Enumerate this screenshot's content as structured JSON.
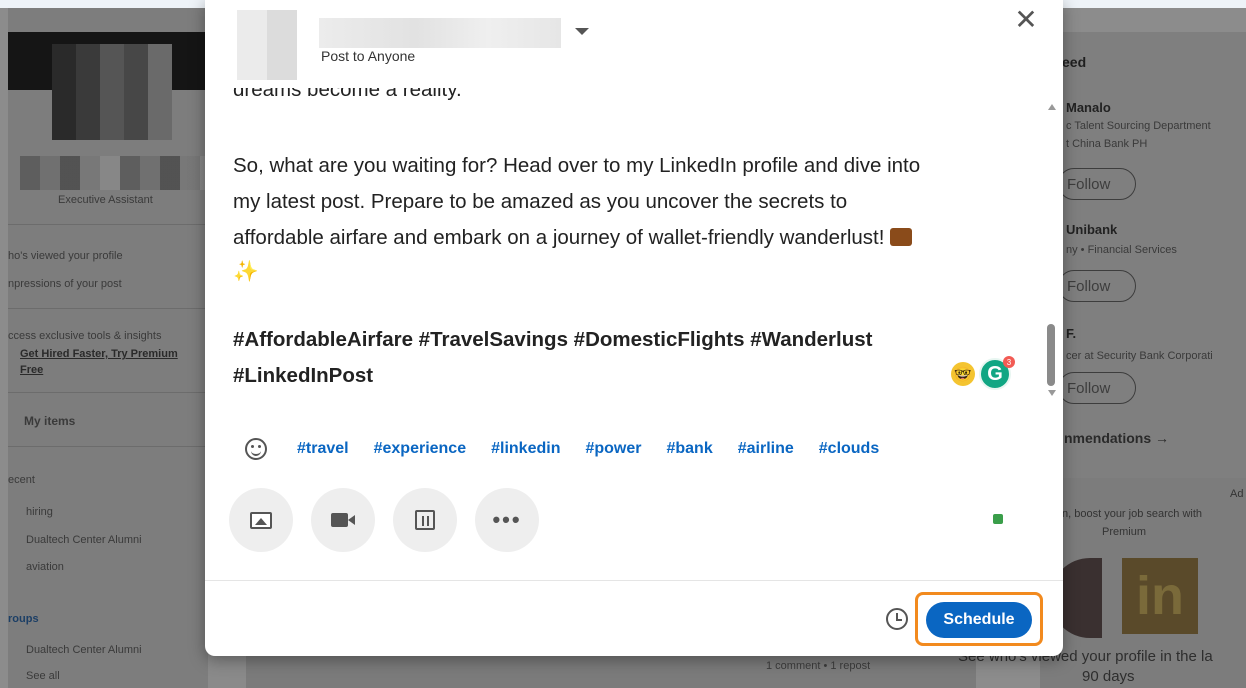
{
  "modal": {
    "visibility_label": "Post to Anyone",
    "close_glyph": "✕",
    "editor": {
      "cut_line": "dreams become a reality.",
      "paragraph_lines": [
        "So, what are you waiting for? Head over to my LinkedIn profile and dive into",
        "my latest post. Prepare to be amazed as you uncover the secrets to",
        "affordable airfare and embark on a journey of wallet-friendly wanderlust!",
        "✨"
      ],
      "hashtag_lines": [
        "#AffordableAirfare #TravelSavings #DomesticFlights #Wanderlust",
        "#LinkedInPost"
      ]
    },
    "grammarly_letter": "G",
    "grammarly_count": "3",
    "nerd_emoji": "🤓",
    "suggested_hashtags": [
      "#travel",
      "#experience",
      "#linkedin",
      "#power",
      "#bank",
      "#airline",
      "#clouds"
    ],
    "toolbar_icons": [
      "photo-icon",
      "video-icon",
      "calendar-icon",
      "more-icon"
    ],
    "more_glyph": "•••",
    "schedule_label": "Schedule"
  },
  "background": {
    "left": {
      "headline": "Executive Assistant",
      "viewed_profile": "ho's viewed your profile",
      "impressions": "npressions of your post",
      "premium_teaser": "ccess exclusive tools & insights",
      "premium_link": "Get Hired Faster, Try Premium",
      "premium_link_2": "Free",
      "my_items": "My items",
      "recent_header": "ecent",
      "recent_items": [
        "hiring",
        "Dualtech Center Alumni",
        "aviation"
      ],
      "groups_header": "roups",
      "groups_items": [
        "Dualtech Center Alumni"
      ],
      "see_all": "See all"
    },
    "right": {
      "feed_header": "eed",
      "people": [
        {
          "name": "Manalo",
          "line1": "c Talent Sourcing Department",
          "line2": "t China Bank PH"
        },
        {
          "name": "Unibank",
          "line1": "ny • Financial Services",
          "line2": ""
        },
        {
          "name": "F.",
          "line1": "cer at Security Bank Corporati",
          "line2": ""
        }
      ],
      "follow_label": "Follow",
      "recommendations": "nmendations →",
      "ad_label": "Ad",
      "ad_text_1": "n, boost your job search with",
      "ad_text_2": "Premium",
      "ad_logo": "in",
      "ad_bottom_1": "See who's viewed your profile in the la",
      "ad_bottom_2": "90 days"
    },
    "feed_bottom": "1 comment • 1 repost"
  }
}
